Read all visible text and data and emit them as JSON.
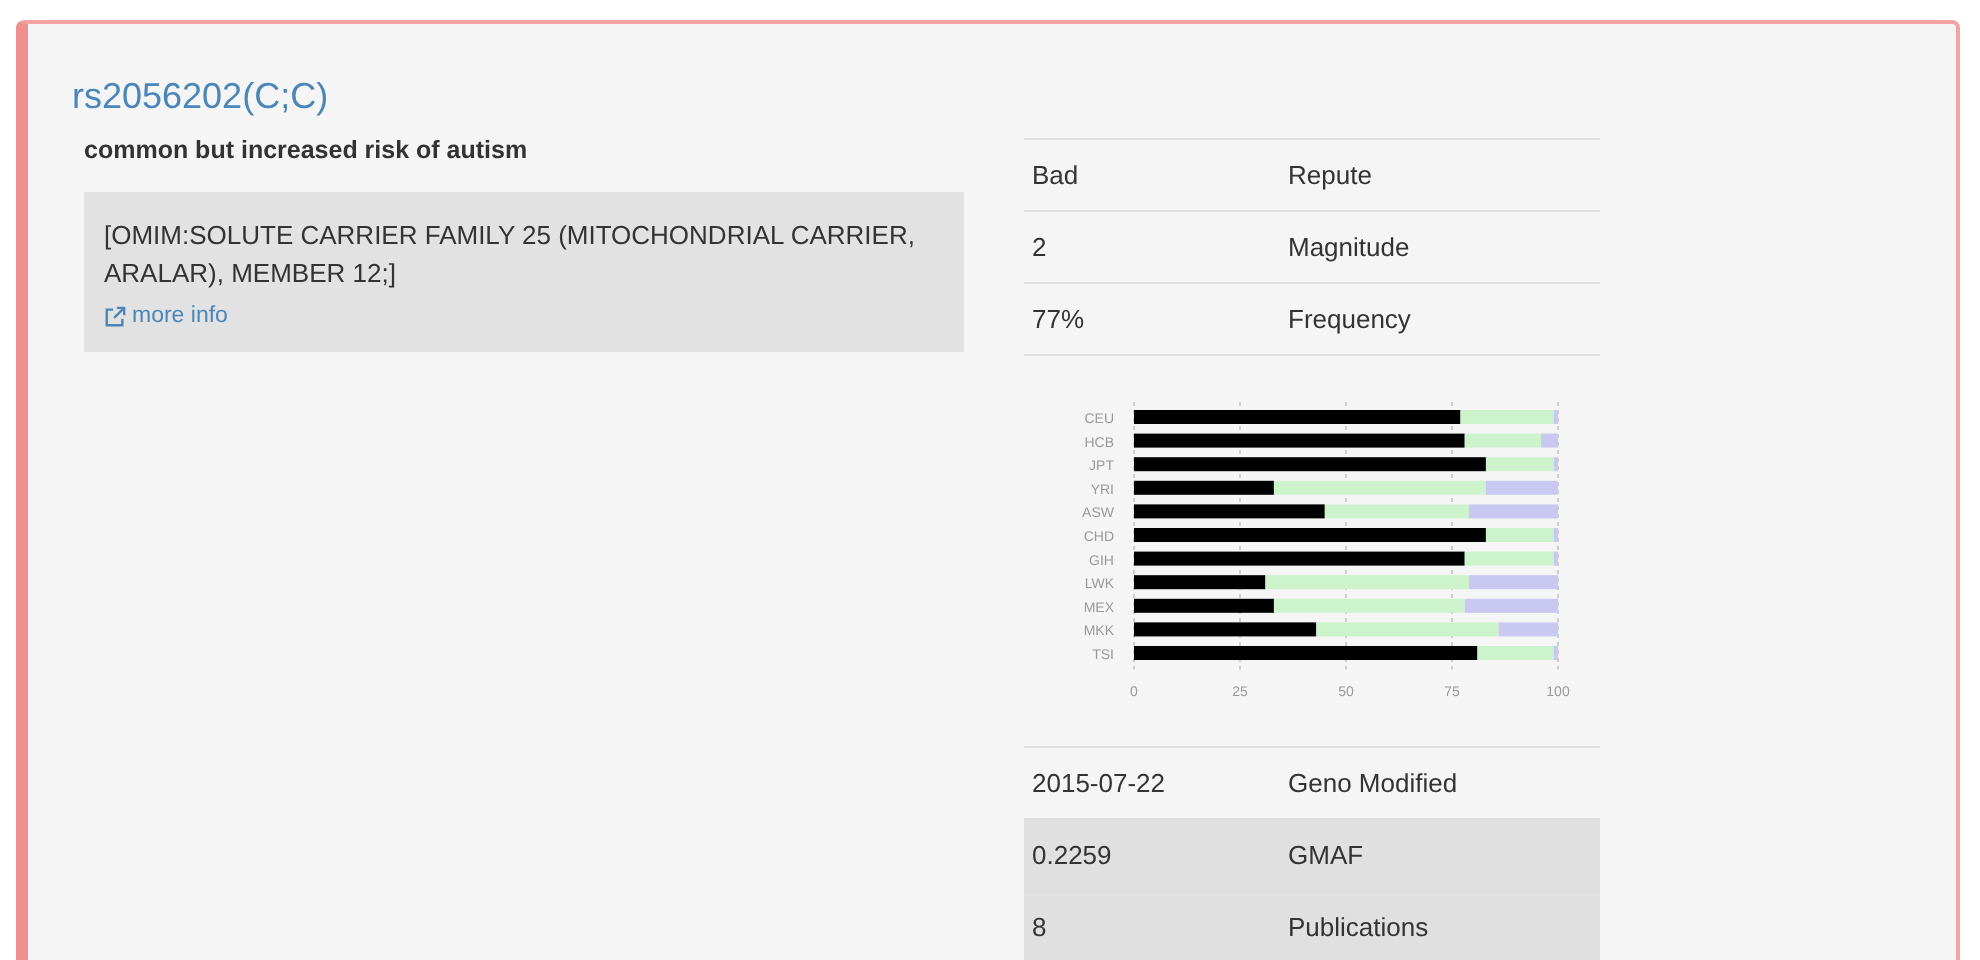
{
  "title": "rs2056202(C;C)",
  "summary": "common but increased risk of autism",
  "omim": {
    "text": "[OMIM:SOLUTE CARRIER FAMILY 25 (MITOCHONDRIAL CARRIER, ARALAR), MEMBER 12;]",
    "link": "more info"
  },
  "facts_top": [
    {
      "value": "Bad",
      "label": "Repute",
      "shaded": false
    },
    {
      "value": "2",
      "label": "Magnitude",
      "shaded": false
    },
    {
      "value": "77%",
      "label": "Frequency",
      "shaded": false
    }
  ],
  "chart_data": {
    "type": "bar",
    "orientation": "horizontal",
    "stacked": true,
    "categories": [
      "CEU",
      "HCB",
      "JPT",
      "YRI",
      "ASW",
      "CHD",
      "GIH",
      "LWK",
      "MEX",
      "MKK",
      "TSI"
    ],
    "xlim": [
      0,
      100
    ],
    "xticks": [
      0,
      25,
      50,
      75,
      100
    ],
    "grid": true,
    "series": [
      {
        "color": "#000000",
        "values": [
          77,
          78,
          83,
          33,
          45,
          83,
          78,
          31,
          33,
          43,
          81
        ]
      },
      {
        "color": "#cdf3cd",
        "values": [
          22,
          18,
          16,
          50,
          34,
          16,
          21,
          48,
          45,
          43,
          18
        ]
      },
      {
        "color": "#c8c8f0",
        "values": [
          1,
          4,
          1,
          17,
          21,
          1,
          1,
          21,
          22,
          14,
          1
        ]
      }
    ]
  },
  "facts_bottom": [
    {
      "value": "2015-07-22",
      "label": "Geno Modified",
      "shaded": false
    },
    {
      "value": "0.2259",
      "label": "GMAF",
      "shaded": true
    },
    {
      "value": "8",
      "label": "Publications",
      "shaded": true
    }
  ]
}
